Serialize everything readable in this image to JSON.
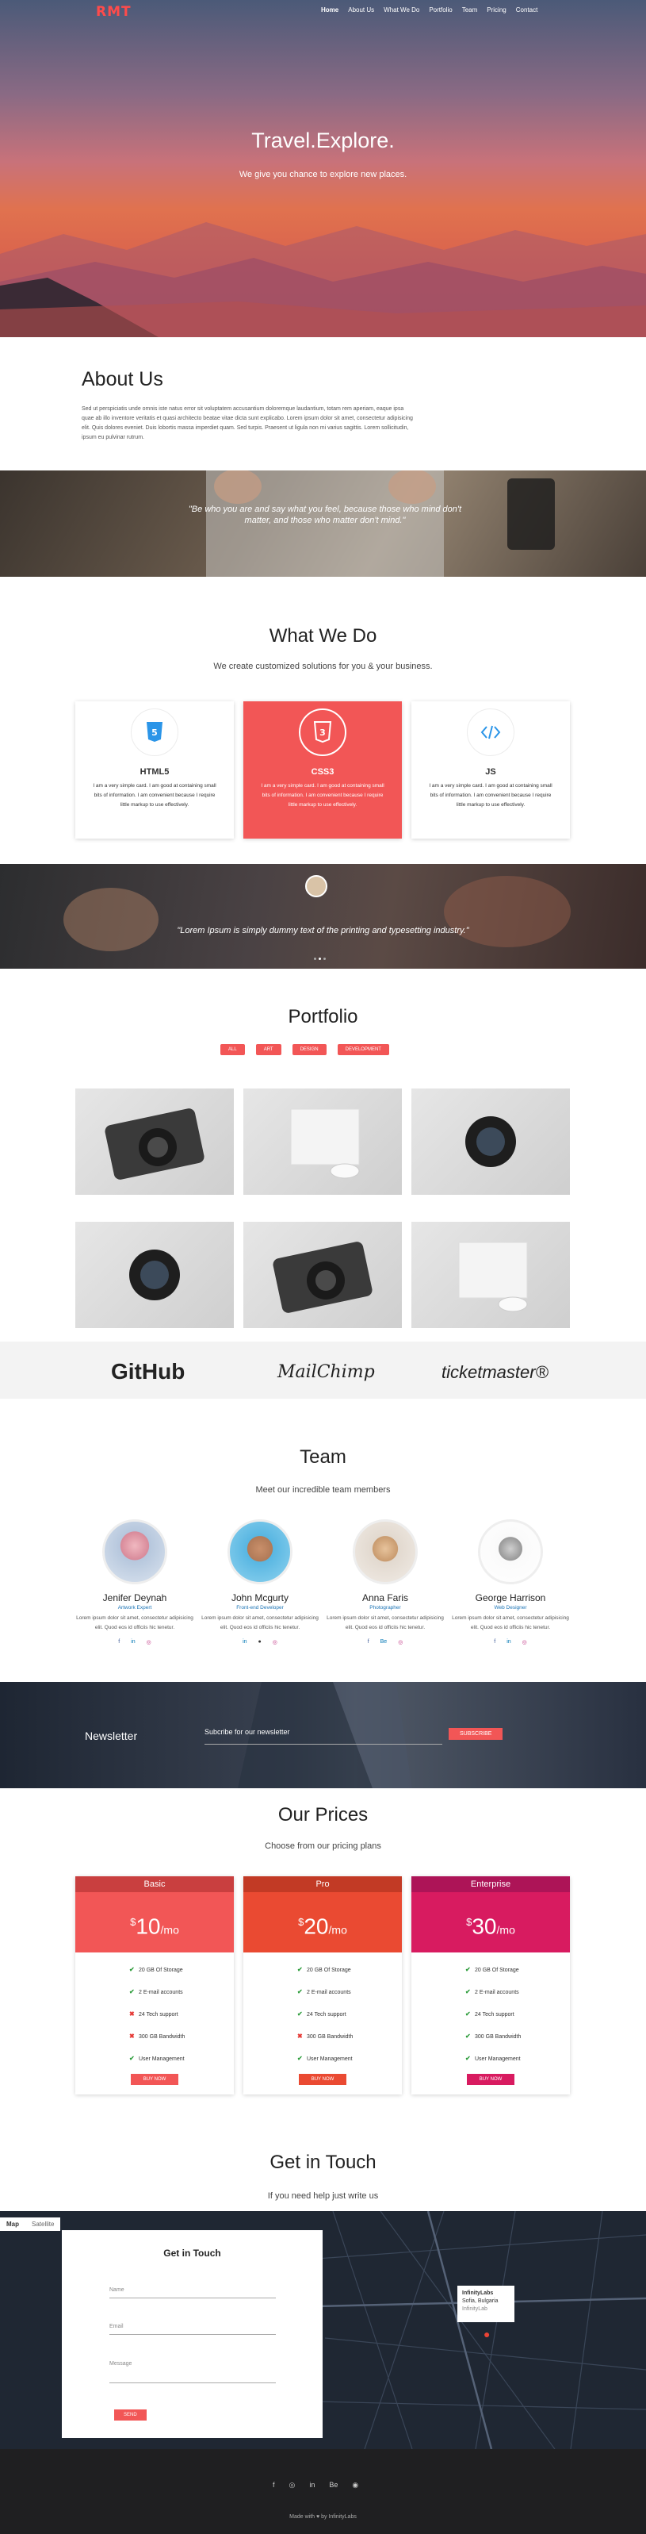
{
  "brand": {
    "logo": "RMT"
  },
  "nav": [
    "Home",
    "About Us",
    "What We Do",
    "Portfolio",
    "Team",
    "Pricing",
    "Contact"
  ],
  "hero": {
    "title": "Travel.Explore.",
    "subtitle": "We give you chance to explore new places."
  },
  "about": {
    "title": "About Us",
    "text": "Sed ut perspiciatis unde omnis iste natus error sit voluptatem accusantium doloremque laudantium, totam rem aperiam, eaque ipsa quae ab illo inventore veritatis et quasi architecto beatae vitae dicta sunt explicabo. Lorem ipsum dolor sit amet, consectetur adipisicing elit. Quis dolores eveniet. Duis lobortis massa imperdiet quam. Sed turpis. Praesent ut ligula non mi varius sagittis. Lorem sollicitudin, ipsum eu pulvinar rutrum."
  },
  "quote1": "\"Be who you are and say what you feel, because those who mind don't matter, and those who matter don't mind.\"",
  "what_we_do": {
    "title": "What We Do",
    "subtitle": "We create customized solutions for you & your business.",
    "cards": [
      {
        "title": "HTML5",
        "icon": "html5-icon",
        "text": "I am a very simple card. I am good at containing small bits of information. I am convenient because I require little markup to use effectively."
      },
      {
        "title": "CSS3",
        "icon": "css3-icon",
        "text": "I am a very simple card. I am good at containing small bits of information. I am convenient because I require little markup to use effectively."
      },
      {
        "title": "JS",
        "icon": "code-icon",
        "text": "I am a very simple card. I am good at containing small bits of information. I am convenient because I require little markup to use effectively."
      }
    ]
  },
  "testimonial": {
    "text": "\"Lorem Ipsum is simply dummy text of the printing and typesetting industry.\""
  },
  "portfolio": {
    "title": "Portfolio",
    "filters": [
      "ALL",
      "ART",
      "DESIGN",
      "DEVELOPMENT"
    ],
    "items": [
      "camera",
      "console",
      "lens",
      "lens",
      "camera",
      "console"
    ]
  },
  "brands": [
    "GitHub",
    "MailChimp",
    "ticketmaster®"
  ],
  "team": {
    "title": "Team",
    "subtitle": "Meet our incredible team members",
    "members": [
      {
        "name": "Jenifer Deynah",
        "role": "Artwork Expert",
        "bio": "Lorem ipsum dolor sit amet, consectetur adipisicing elit. Quod eos id officiis hic tenetur."
      },
      {
        "name": "John Mcgurty",
        "role": "Front-end Developer",
        "bio": "Lorem ipsum dolor sit amet, consectetur adipisicing elit. Quod eos id officiis hic tenetur."
      },
      {
        "name": "Anna Faris",
        "role": "Photographer",
        "bio": "Lorem ipsum dolor sit amet, consectetur adipisicing elit. Quod eos id officiis hic tenetur."
      },
      {
        "name": "George Harrison",
        "role": "Web Designer",
        "bio": "Lorem ipsum dolor sit amet, consectetur adipisicing elit. Quod eos id officiis hic tenetur."
      }
    ]
  },
  "newsletter": {
    "title": "Newsletter",
    "label": "Subcribe for our newsletter",
    "button": "SUBSCRIBE"
  },
  "prices": {
    "title": "Our Prices",
    "subtitle": "Choose from our pricing plans",
    "plans": [
      {
        "name": "Basic",
        "price": "10",
        "color": "#f25656",
        "head": "#c93f3f",
        "features": [
          "20 GB Of Storage",
          "2 E-mail accounts",
          "24 Tech support",
          "300 GB Bandwidth",
          "User Management"
        ],
        "ok": [
          true,
          true,
          false,
          false,
          true
        ],
        "button": "BUY NOW"
      },
      {
        "name": "Pro",
        "price": "20",
        "color": "#ea4a32",
        "head": "#c23a25",
        "features": [
          "20 GB Of Storage",
          "2 E-mail accounts",
          "24 Tech support",
          "300 GB Bandwidth",
          "User Management"
        ],
        "ok": [
          true,
          true,
          true,
          false,
          true
        ],
        "button": "BUY NOW"
      },
      {
        "name": "Enterprise",
        "price": "30",
        "color": "#d81b60",
        "head": "#ad1457",
        "features": [
          "20 GB Of Storage",
          "2 E-mail accounts",
          "24 Tech support",
          "300 GB Bandwidth",
          "User Management"
        ],
        "ok": [
          true,
          true,
          true,
          true,
          true
        ],
        "button": "BUY NOW"
      }
    ],
    "currency": "$",
    "per": "/mo"
  },
  "contact": {
    "title": "Get in Touch",
    "subtitle": "If you need help just write us",
    "map_tabs": [
      "Map",
      "Satellite"
    ],
    "form_title": "Get in Touch",
    "fields": [
      "Name",
      "Email",
      "Message"
    ],
    "send": "SEND",
    "pin": {
      "title": "InfinityLabs",
      "line1": "Sofia, Bulgaria",
      "line2": "InfinityLab"
    }
  },
  "footer": {
    "social": [
      "f",
      "◎",
      "in",
      "Be",
      "◉"
    ],
    "credit": "Made with ♥ by InfinityLabs"
  }
}
